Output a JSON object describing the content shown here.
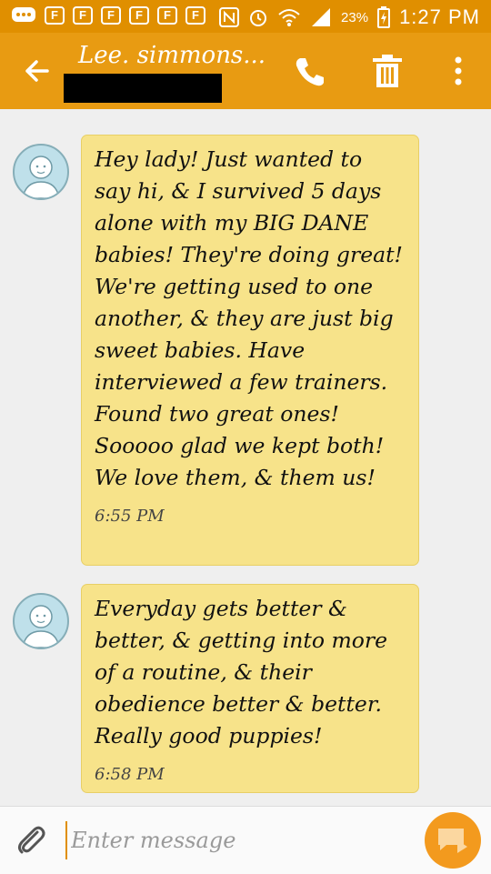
{
  "status_bar": {
    "notifications": [
      "F",
      "F",
      "F",
      "F",
      "F",
      "F"
    ],
    "battery": "23%",
    "time": "1:27 PM"
  },
  "header": {
    "contact_name": "Lee. simmons..."
  },
  "messages": [
    {
      "text": "Hey lady! Just wanted to say hi, & I survived 5 days alone with my BIG DANE babies! They're doing great! We're getting used to one another, & they are just big sweet babies. Have interviewed a few trainers. Found two great ones! Sooooo glad we kept both! We love them, & them us!",
      "time": "6:55 PM"
    },
    {
      "text": "Everyday gets better & better, & getting into more of a routine, & their obedience better & better. Really good puppies!",
      "time": "6:58 PM"
    }
  ],
  "composer": {
    "placeholder": "Enter message"
  },
  "colors": {
    "accent": "#e89b12",
    "status_bar": "#e08f00",
    "bubble": "#f7e38a",
    "send_button": "#f39a1e"
  }
}
